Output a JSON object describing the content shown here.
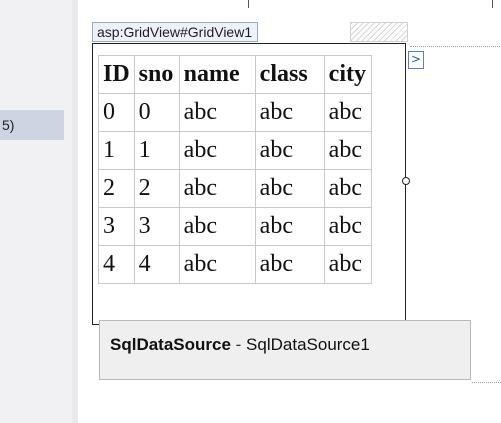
{
  "left_panel": {
    "item_label": "5)"
  },
  "gridview": {
    "tag_label": "asp:GridView#GridView1",
    "smart_tag_glyph": ">",
    "columns": [
      "ID",
      "sno",
      "name",
      "class",
      "city"
    ],
    "rows": [
      [
        "0",
        "0",
        "abc",
        "abc",
        "abc"
      ],
      [
        "1",
        "1",
        "abc",
        "abc",
        "abc"
      ],
      [
        "2",
        "2",
        "abc",
        "abc",
        "abc"
      ],
      [
        "3",
        "3",
        "abc",
        "abc",
        "abc"
      ],
      [
        "4",
        "4",
        "abc",
        "abc",
        "abc"
      ]
    ]
  },
  "sqldatasource": {
    "type_label": "SqlDataSource",
    "separator": " - ",
    "id_label": "SqlDataSource1"
  },
  "colors": {
    "selection_border": "#222222",
    "tag_background": "#eef2f8",
    "smart_tag_accent": "#2b57b0",
    "control_background": "#efefef"
  }
}
